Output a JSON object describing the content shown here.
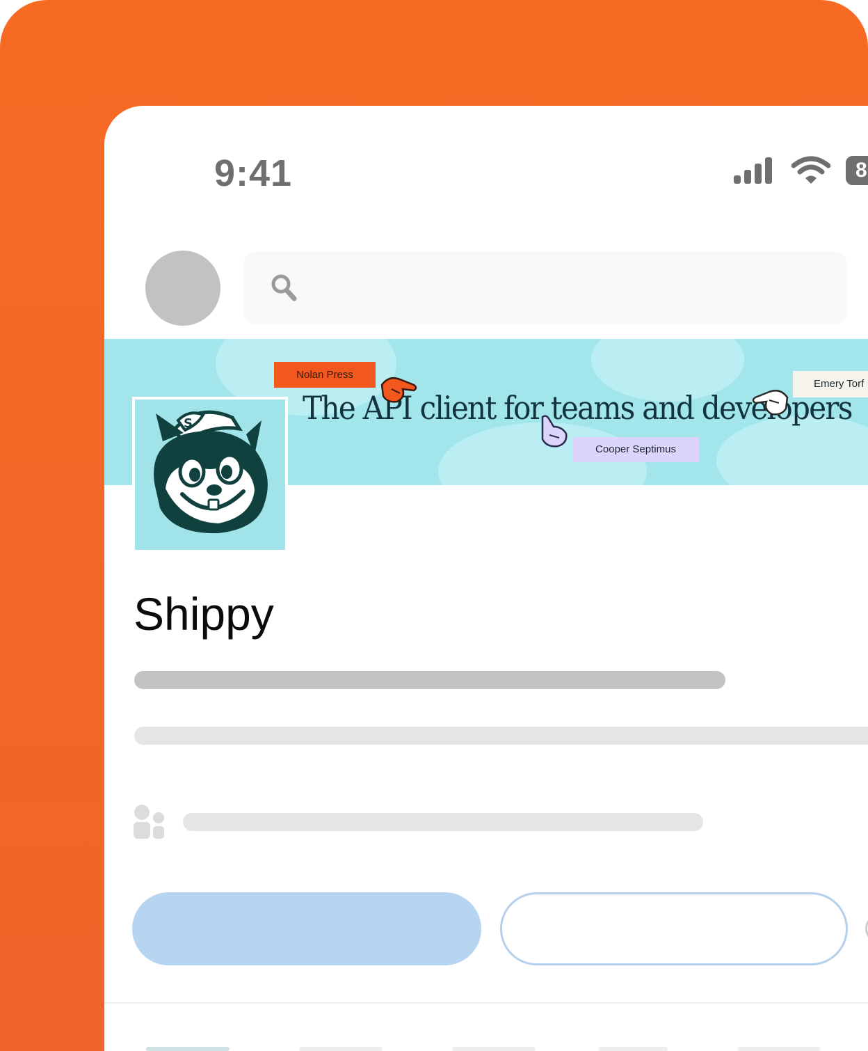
{
  "status_bar": {
    "time": "9:41",
    "battery_text": "8"
  },
  "banner": {
    "headline": "The API client for teams and developers",
    "tags": {
      "nolan": "Nolan Press",
      "cooper": "Cooper Septimus",
      "emery": "Emery Torf"
    }
  },
  "profile": {
    "name": "Shippy"
  },
  "colors": {
    "brand_orange": "#f76a24",
    "banner_teal": "#a2e6ec",
    "primary_button": "#b7d4f1",
    "skeleton_dark": "#c2c3c4",
    "skeleton_light": "#e4e6e6"
  },
  "icons": {
    "search": "search-icon",
    "signal": "cellular-signal-icon",
    "wifi": "wifi-icon",
    "battery": "battery-icon",
    "people": "people-icon",
    "logo": "squirrel-mascot-logo"
  }
}
